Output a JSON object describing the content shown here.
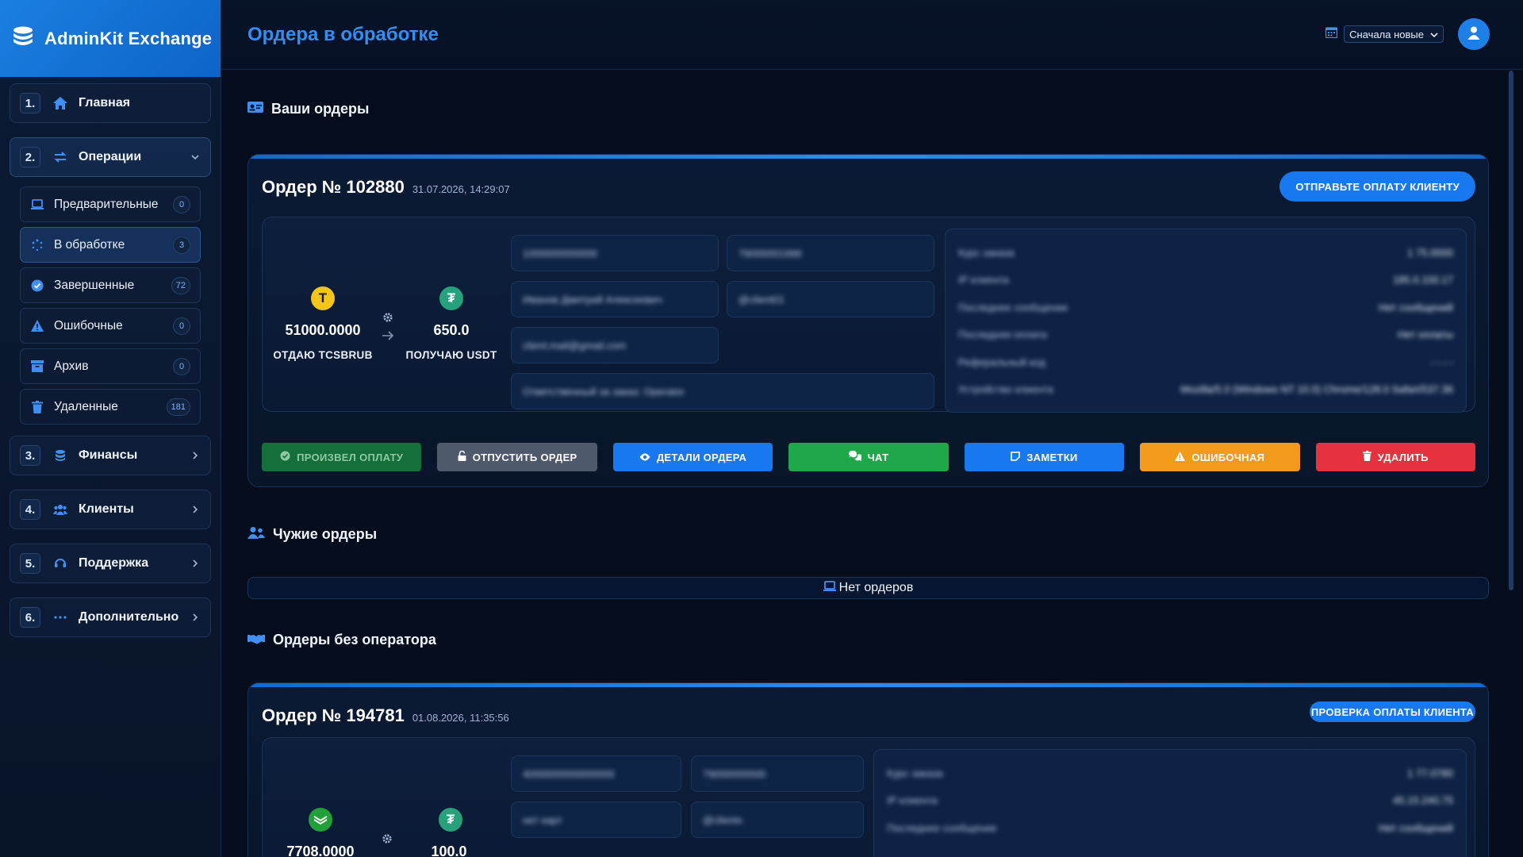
{
  "app": {
    "name": "AdminKit Exchange"
  },
  "sidebar": {
    "items": [
      {
        "num": "1.",
        "label": "Главная"
      },
      {
        "num": "2.",
        "label": "Операции"
      },
      {
        "num": "3.",
        "label": "Финансы"
      },
      {
        "num": "4.",
        "label": "Клиенты"
      },
      {
        "num": "5.",
        "label": "Поддержка"
      },
      {
        "num": "6.",
        "label": "Дополнительно"
      }
    ],
    "operations_sub": [
      {
        "label": "Предварительные",
        "count": "0"
      },
      {
        "label": "В обработке",
        "count": "3"
      },
      {
        "label": "Завершенные",
        "count": "72"
      },
      {
        "label": "Ошибочные",
        "count": "0"
      },
      {
        "label": "Архив",
        "count": "0"
      },
      {
        "label": "Удаленные",
        "count": "181"
      }
    ]
  },
  "header": {
    "title": "Ордера в обработке",
    "sort_value": "Сначала новые"
  },
  "sections": {
    "mine": "Ваши ордеры",
    "others": "Чужие ордеры",
    "no_operator": "Ордеры без оператора",
    "others_empty": "Нет ордеров"
  },
  "orders": [
    {
      "number": "Ордер № 102880",
      "date": "31.07.2026, 14:29:07",
      "status": "ОТПРАВЬТЕ ОПЛАТУ КЛИЕНТУ",
      "give_amount": "51000.0000",
      "give_label": "ОТДАЮ TCSBRUB",
      "get_amount": "650.0",
      "get_label": "ПОЛУЧАЮ USDT",
      "fields": [
        "1000000000000",
        "79000001999",
        "Иванов Дмитрий Алексеевич",
        "@client01",
        "client.mail@gmail.com",
        "Ответственный за заказ: Operator"
      ],
      "info": [
        [
          "Курс заказа",
          "1 75.0000"
        ],
        [
          "IP клиента",
          "185.0.100.17"
        ],
        [
          "Последнее сообщение",
          "Нет сообщений"
        ],
        [
          "Последняя оплата",
          "Нет оплаты"
        ],
        [
          "Реферальный код",
          "- - - -"
        ],
        [
          "Устройство клиента",
          "Mozilla/5.0 (Windows NT 10.0) Chrome/128.0 Safari/537.36"
        ]
      ],
      "actions": [
        "ПРОИЗВЕЛ ОПЛАТУ",
        "ОТПУСТИТЬ ОРДЕР",
        "ДЕТАЛИ ОРДЕРА",
        "ЧАТ",
        "ЗАМЕТКИ",
        "ОШИБОЧНАЯ",
        "УДАЛИТЬ"
      ]
    },
    {
      "number": "Ордер № 194781",
      "date": "01.08.2026, 11:35:56",
      "status": "ПРОВЕРКА ОПЛАТЫ КЛИЕНТА",
      "give_amount": "7708.0000",
      "get_amount": "100.0",
      "fields": [
        "4000000000000000",
        "79000000000",
        "нет карт",
        "@clientx"
      ],
      "info": [
        [
          "Курс заказа",
          "1 77.0780"
        ],
        [
          "IP клиента",
          "45.15.240.75"
        ],
        [
          "Последнее сообщение",
          "Нет сообщений"
        ]
      ]
    }
  ],
  "colors": {
    "accent": "#1778f0",
    "success": "#1fa84a",
    "warning": "#f39a1a",
    "danger": "#e6323e"
  }
}
